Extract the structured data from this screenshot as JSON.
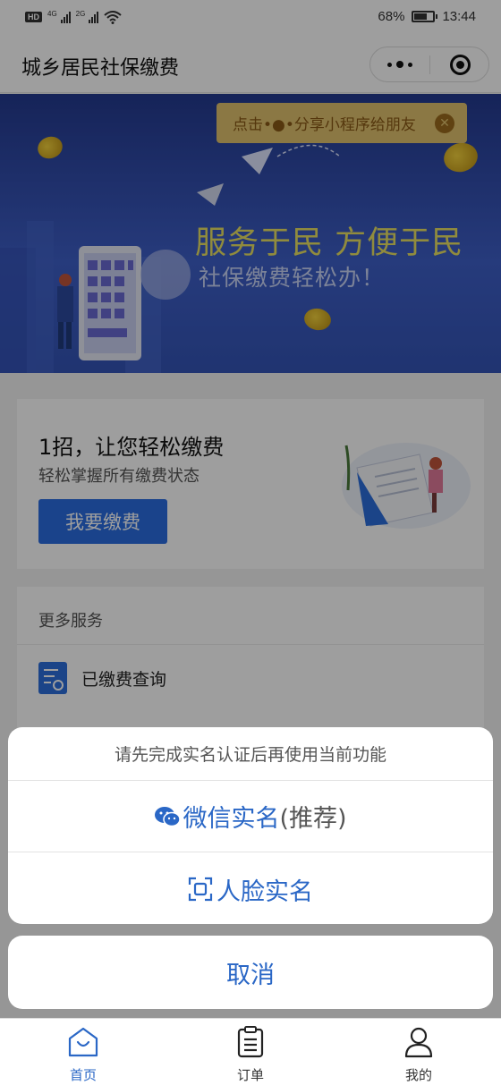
{
  "status_bar": {
    "net1": "4G",
    "net2": "2G",
    "battery": "68%",
    "battery_level": 0.68,
    "time": "13:44"
  },
  "nav": {
    "title": "城乡居民社保缴费"
  },
  "banner": {
    "share_tip": "点击•●•分享小程序给朋友",
    "headline": "服务于民  方便于民",
    "subline": "社保缴费轻松办！"
  },
  "card": {
    "title": "1招，让您轻松缴费",
    "subtitle": "轻松掌握所有缴费状态",
    "button": "我要缴费"
  },
  "services": {
    "header": "更多服务",
    "items": [
      {
        "label": "已缴费查询"
      }
    ]
  },
  "action_sheet": {
    "tip": "请先完成实名认证后再使用当前功能",
    "wechat_label": "微信实名",
    "wechat_note": "(推荐)",
    "face_label": "人脸实名",
    "cancel": "取消"
  },
  "tabbar": {
    "items": [
      {
        "label": "首页"
      },
      {
        "label": "订单"
      },
      {
        "label": "我的"
      }
    ]
  },
  "colors": {
    "accent": "#2a67c6",
    "banner_blue": "#3e5fc8",
    "banner_yellow": "#e9e063",
    "share_bg": "#e0c26e"
  }
}
